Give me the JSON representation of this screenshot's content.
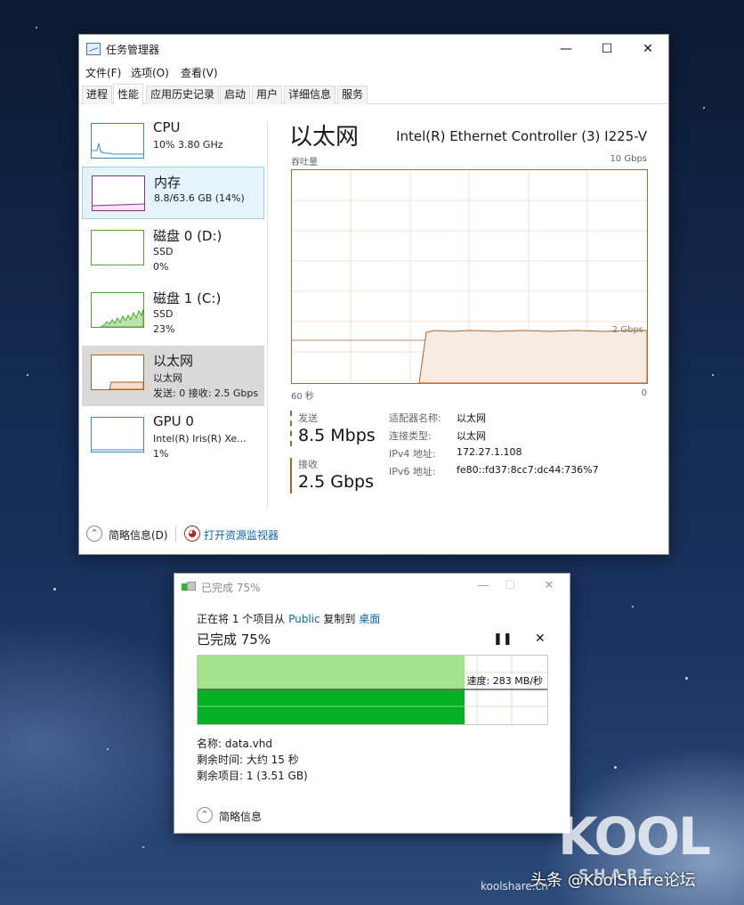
{
  "task_manager": {
    "title": "任务管理器",
    "menu": [
      "文件(F)",
      "选项(O)",
      "查看(V)"
    ],
    "tabs": [
      "进程",
      "性能",
      "应用历史记录",
      "启动",
      "用户",
      "详细信息",
      "服务"
    ],
    "active_tab": "性能",
    "sidebar": [
      {
        "name": "CPU",
        "sub1": "10% 3.80 GHz",
        "color": "#3a87c9"
      },
      {
        "name": "内存",
        "sub1": "8.8/63.6 GB (14%)",
        "color": "#8b2c9b"
      },
      {
        "name": "磁盘 0 (D:)",
        "sub1": "SSD",
        "sub2": "0%",
        "color": "#4ea72e"
      },
      {
        "name": "磁盘 1 (C:)",
        "sub1": "SSD",
        "sub2": "23%",
        "color": "#4ea72e"
      },
      {
        "name": "以太网",
        "sub1": "以太网",
        "sub2": "发送: 0 接收: 2.5 Gbps",
        "color": "#a8652a"
      },
      {
        "name": "GPU 0",
        "sub1": "Intel(R) Iris(R) Xe...",
        "sub2": "1%",
        "color": "#3a87c9"
      }
    ],
    "main": {
      "title": "以太网",
      "adapter": "Intel(R) Ethernet Controller (3) I225-V",
      "throughput_label": "吞吐量",
      "max_label": "10 Gbps",
      "marker_label": "2 Gbps",
      "time_left": "60 秒",
      "time_right": "0",
      "send_label": "发送",
      "send_value": "8.5 Mbps",
      "recv_label": "接收",
      "recv_value": "2.5 Gbps",
      "details": [
        {
          "k": "适配器名称:",
          "v": "以太网"
        },
        {
          "k": "连接类型:",
          "v": "以太网"
        },
        {
          "k": "IPv4 地址:",
          "v": "172.27.1.108"
        },
        {
          "k": "IPv6 地址:",
          "v": "fe80::fd37:8cc7:dc44:736%7"
        }
      ],
      "colors": {
        "accent": "#a8652a",
        "fill": "#f8ece2"
      }
    },
    "footer": {
      "summary": "简略信息(D)",
      "monitor": "打开资源监视器"
    }
  },
  "copy_dialog": {
    "title": "已完成 75%",
    "line_prefix": "正在将 1 个项目从 ",
    "source": "Public",
    "line_mid": " 复制到 ",
    "dest": "桌面",
    "progress_text": "已完成 75%",
    "progress": 0.75,
    "speed": "速度: 283 MB/秒",
    "name": "名称: data.vhd",
    "time_left": "剩余时间: 大约 15 秒",
    "items_left": "剩余项目: 1 (3.51 GB)",
    "summary": "简略信息",
    "colors": {
      "bar": "#06b025",
      "fill": "#a3e38c"
    }
  },
  "watermark": {
    "logo": "KOOL",
    "sub": "S H A R E",
    "site": "koolshare.cn",
    "toutiao": "头条 @KoolShare论坛"
  }
}
